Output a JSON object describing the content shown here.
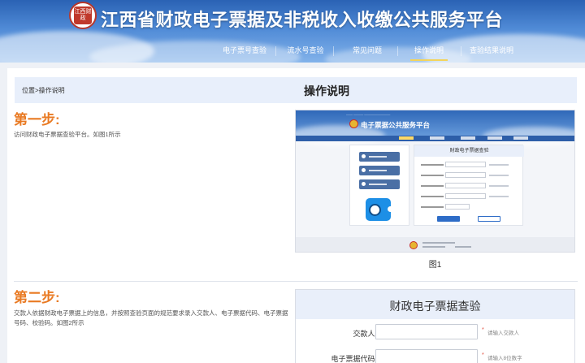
{
  "site": {
    "title": "江西省财政电子票据及非税收入收缴公共服务平台",
    "emblem_text": "江西财政"
  },
  "nav": {
    "items": [
      "电子票号查验",
      "流水号查验",
      "常见问题",
      "操作说明",
      "查验结果说明"
    ],
    "active_index": 3
  },
  "breadcrumb": "位置>操作说明",
  "page_title": "操作说明",
  "steps": [
    {
      "title": "第一步:",
      "text": "访问财政电子票据查验平台。如图1所示"
    },
    {
      "title": "第二步:",
      "text": "交款人依据财政电子票据上的信息，并按照查验页面的规范要求录入交款人、电子票据代码、电子票据号码、校验码。如图2所示"
    }
  ],
  "figure1": {
    "title": "电子票据公共服务平台",
    "form_title": "财政电子票据查验",
    "caption": "图1"
  },
  "figure2": {
    "title": "财政电子票据查验",
    "fields": [
      {
        "label": "交款人:",
        "hint": "请输入交款人",
        "value": ""
      },
      {
        "label": "电子票据代码:",
        "hint": "请输入8位数字",
        "value": ""
      }
    ],
    "required_mark": "*"
  },
  "colors": {
    "accent_orange": "#e97a23",
    "nav_active": "#f3d45b",
    "banner_blue": "#2a62b4"
  }
}
